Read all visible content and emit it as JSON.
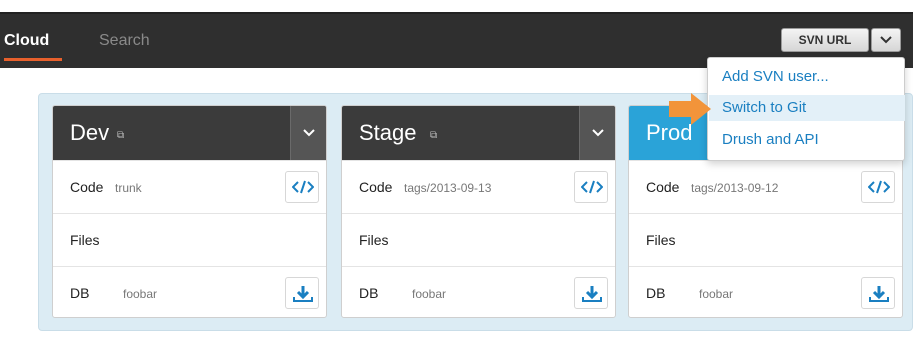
{
  "nav": {
    "tabs": [
      {
        "label": "Cloud",
        "active": true
      },
      {
        "label": "Search",
        "active": false
      }
    ],
    "svn_button_label": "SVN URL",
    "active_accent": "#e8602c"
  },
  "dropdown": {
    "items": [
      {
        "label": "Add SVN user..."
      },
      {
        "label": "Switch to Git",
        "hovered": true
      },
      {
        "label": "Drush and API"
      }
    ]
  },
  "environments": [
    {
      "name": "Dev",
      "header_color": "#3b3b3b",
      "rows": {
        "code_label": "Code",
        "code_value": "trunk",
        "files_label": "Files",
        "db_label": "DB",
        "db_value": "foobar"
      }
    },
    {
      "name": "Stage",
      "header_color": "#3b3b3b",
      "rows": {
        "code_label": "Code",
        "code_value": "tags/2013-09-13",
        "files_label": "Files",
        "db_label": "DB",
        "db_value": "foobar"
      }
    },
    {
      "name": "Prod",
      "header_color": "#2aa3d8",
      "rows": {
        "code_label": "Code",
        "code_value": "tags/2013-09-12",
        "files_label": "Files",
        "db_label": "DB",
        "db_value": "foobar"
      }
    }
  ],
  "icons": {
    "external_link": "external-link-icon",
    "caret": "chevron-down-icon",
    "code": "code-icon",
    "download": "download-icon",
    "pointer": "arrow-pointer-icon"
  }
}
